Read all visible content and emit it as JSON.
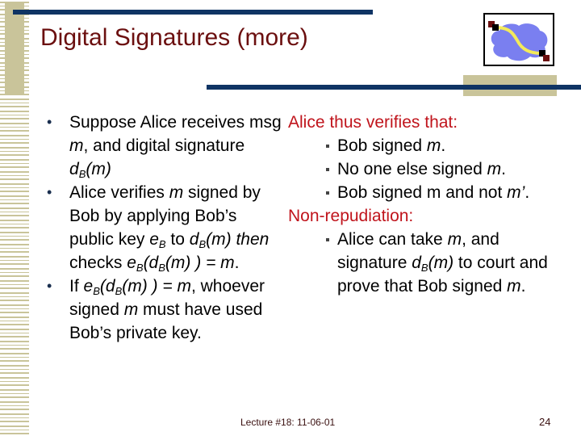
{
  "slide": {
    "title": "Digital Signatures (more)",
    "logo_icon": "network-signature-icon",
    "colors": {
      "title": "#6b0f0f",
      "accent_bar": "#0f3464",
      "accent_tan": "#c9c49a",
      "heading_red": "#c0141c"
    },
    "left_column": {
      "bullets": [
        {
          "parts": [
            "Suppose Alice receives msg ",
            "m",
            ", and digital signature ",
            "d",
            "B",
            "(m)"
          ]
        },
        {
          "parts": [
            "Alice verifies ",
            "m",
            " signed by Bob by applying Bob’s public key ",
            "e",
            "B",
            " to ",
            "d",
            "B",
            "(m) then",
            " checks ",
            "e",
            "B",
            "(d",
            "B",
            "(m) ) = m",
            "."
          ]
        },
        {
          "parts": [
            "If ",
            "e",
            "B",
            "(d",
            "B",
            "(m) ) = m",
            ", whoever signed ",
            "m",
            " must have used Bob’s private key."
          ]
        }
      ]
    },
    "right_column": {
      "heading1": "Alice thus verifies that:",
      "items1": [
        {
          "parts": [
            "Bob signed ",
            "m",
            "."
          ]
        },
        {
          "parts": [
            "No one else signed ",
            "m",
            "."
          ]
        },
        {
          "parts": [
            "Bob signed m and not ",
            "m’",
            "."
          ]
        }
      ],
      "heading2": "Non-repudiation:",
      "items2": [
        {
          "parts": [
            "Alice can take ",
            "m",
            ", and signature ",
            "d",
            "B",
            "(m)",
            " to court and prove that Bob signed ",
            "m",
            "."
          ]
        }
      ]
    },
    "footer": {
      "lecture": "Lecture #18: 11-06-01",
      "page_number": "24"
    },
    "bullet_glyph": "•"
  }
}
